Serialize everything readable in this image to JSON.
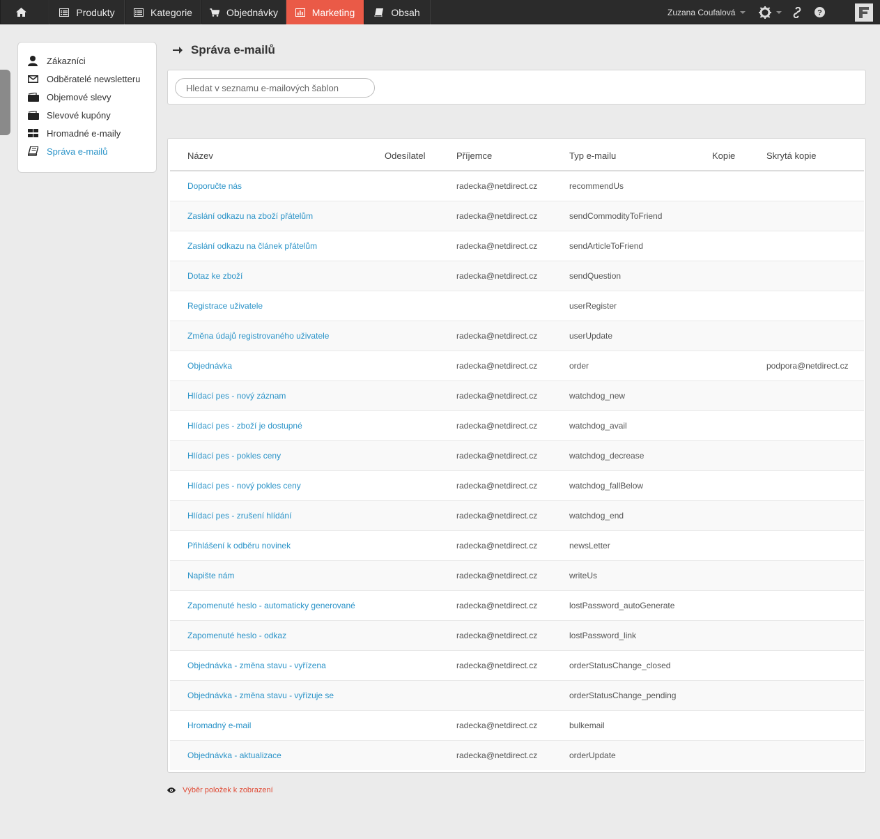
{
  "nav": {
    "home": "",
    "items": [
      {
        "label": "Produkty"
      },
      {
        "label": "Kategorie"
      },
      {
        "label": "Objednávky"
      },
      {
        "label": "Marketing"
      },
      {
        "label": "Obsah"
      }
    ],
    "user_name": "Zuzana Coufalová",
    "accent_color": "#ea5a47"
  },
  "sidebar": {
    "items": [
      {
        "label": "Zákazníci",
        "icon": "user-icon"
      },
      {
        "label": "Odběratelé newsletteru",
        "icon": "envelope-icon"
      },
      {
        "label": "Objemové slevy",
        "icon": "wallet-icon"
      },
      {
        "label": "Slevové kupóny",
        "icon": "wallet-icon"
      },
      {
        "label": "Hromadné e-maily",
        "icon": "grid-icon"
      },
      {
        "label": "Správa e-mailů",
        "icon": "book-icon",
        "active": true
      }
    ]
  },
  "main": {
    "title": "Správa e-mailů",
    "search_placeholder": "Hledat v seznamu e-mailových šablon",
    "table": {
      "headers": [
        "Název",
        "Odesílatel",
        "Příjemce",
        "Typ e-mailu",
        "Kopie",
        "Skrytá kopie"
      ],
      "rows": [
        {
          "name": "Doporučte nás",
          "sender": "",
          "recipient": "radecka@netdirect.cz",
          "type": "recommendUs",
          "copy": "",
          "bcc": ""
        },
        {
          "name": "Zaslání odkazu na zboží přátelům",
          "sender": "",
          "recipient": "radecka@netdirect.cz",
          "type": "sendCommodityToFriend",
          "copy": "",
          "bcc": ""
        },
        {
          "name": "Zaslání odkazu na článek přátelům",
          "sender": "",
          "recipient": "radecka@netdirect.cz",
          "type": "sendArticleToFriend",
          "copy": "",
          "bcc": ""
        },
        {
          "name": "Dotaz ke zboží",
          "sender": "",
          "recipient": "radecka@netdirect.cz",
          "type": "sendQuestion",
          "copy": "",
          "bcc": ""
        },
        {
          "name": "Registrace uživatele",
          "sender": "",
          "recipient": "",
          "type": "userRegister",
          "copy": "",
          "bcc": ""
        },
        {
          "name": "Změna údajů registrovaného uživatele",
          "sender": "",
          "recipient": "radecka@netdirect.cz",
          "type": "userUpdate",
          "copy": "",
          "bcc": ""
        },
        {
          "name": "Objednávka",
          "sender": "",
          "recipient": "radecka@netdirect.cz",
          "type": "order",
          "copy": "",
          "bcc": "podpora@netdirect.cz"
        },
        {
          "name": "Hlídací pes - nový záznam",
          "sender": "",
          "recipient": "radecka@netdirect.cz",
          "type": "watchdog_new",
          "copy": "",
          "bcc": ""
        },
        {
          "name": "Hlídací pes - zboží je dostupné",
          "sender": "",
          "recipient": "radecka@netdirect.cz",
          "type": "watchdog_avail",
          "copy": "",
          "bcc": ""
        },
        {
          "name": "Hlídací pes - pokles ceny",
          "sender": "",
          "recipient": "radecka@netdirect.cz",
          "type": "watchdog_decrease",
          "copy": "",
          "bcc": ""
        },
        {
          "name": "Hlídací pes - nový pokles ceny",
          "sender": "",
          "recipient": "radecka@netdirect.cz",
          "type": "watchdog_fallBelow",
          "copy": "",
          "bcc": ""
        },
        {
          "name": "Hlídací pes - zrušení hlídání",
          "sender": "",
          "recipient": "radecka@netdirect.cz",
          "type": "watchdog_end",
          "copy": "",
          "bcc": ""
        },
        {
          "name": "Přihlášení k odběru novinek",
          "sender": "",
          "recipient": "radecka@netdirect.cz",
          "type": "newsLetter",
          "copy": "",
          "bcc": ""
        },
        {
          "name": "Napište nám",
          "sender": "",
          "recipient": "radecka@netdirect.cz",
          "type": "writeUs",
          "copy": "",
          "bcc": ""
        },
        {
          "name": "Zapomenuté heslo - automaticky generované",
          "sender": "",
          "recipient": "radecka@netdirect.cz",
          "type": "lostPassword_autoGenerate",
          "copy": "",
          "bcc": ""
        },
        {
          "name": "Zapomenuté heslo - odkaz",
          "sender": "",
          "recipient": "radecka@netdirect.cz",
          "type": "lostPassword_link",
          "copy": "",
          "bcc": ""
        },
        {
          "name": "Objednávka - změna stavu - vyřízena",
          "sender": "",
          "recipient": "radecka@netdirect.cz",
          "type": "orderStatusChange_closed",
          "copy": "",
          "bcc": ""
        },
        {
          "name": "Objednávka - změna stavu - vyřizuje se",
          "sender": "",
          "recipient": "",
          "type": "orderStatusChange_pending",
          "copy": "",
          "bcc": ""
        },
        {
          "name": "Hromadný e-mail",
          "sender": "",
          "recipient": "radecka@netdirect.cz",
          "type": "bulkemail",
          "copy": "",
          "bcc": ""
        },
        {
          "name": "Objednávka - aktualizace",
          "sender": "",
          "recipient": "radecka@netdirect.cz",
          "type": "orderUpdate",
          "copy": "",
          "bcc": ""
        }
      ]
    },
    "footer_link": "Výběr položek k zobrazení"
  }
}
